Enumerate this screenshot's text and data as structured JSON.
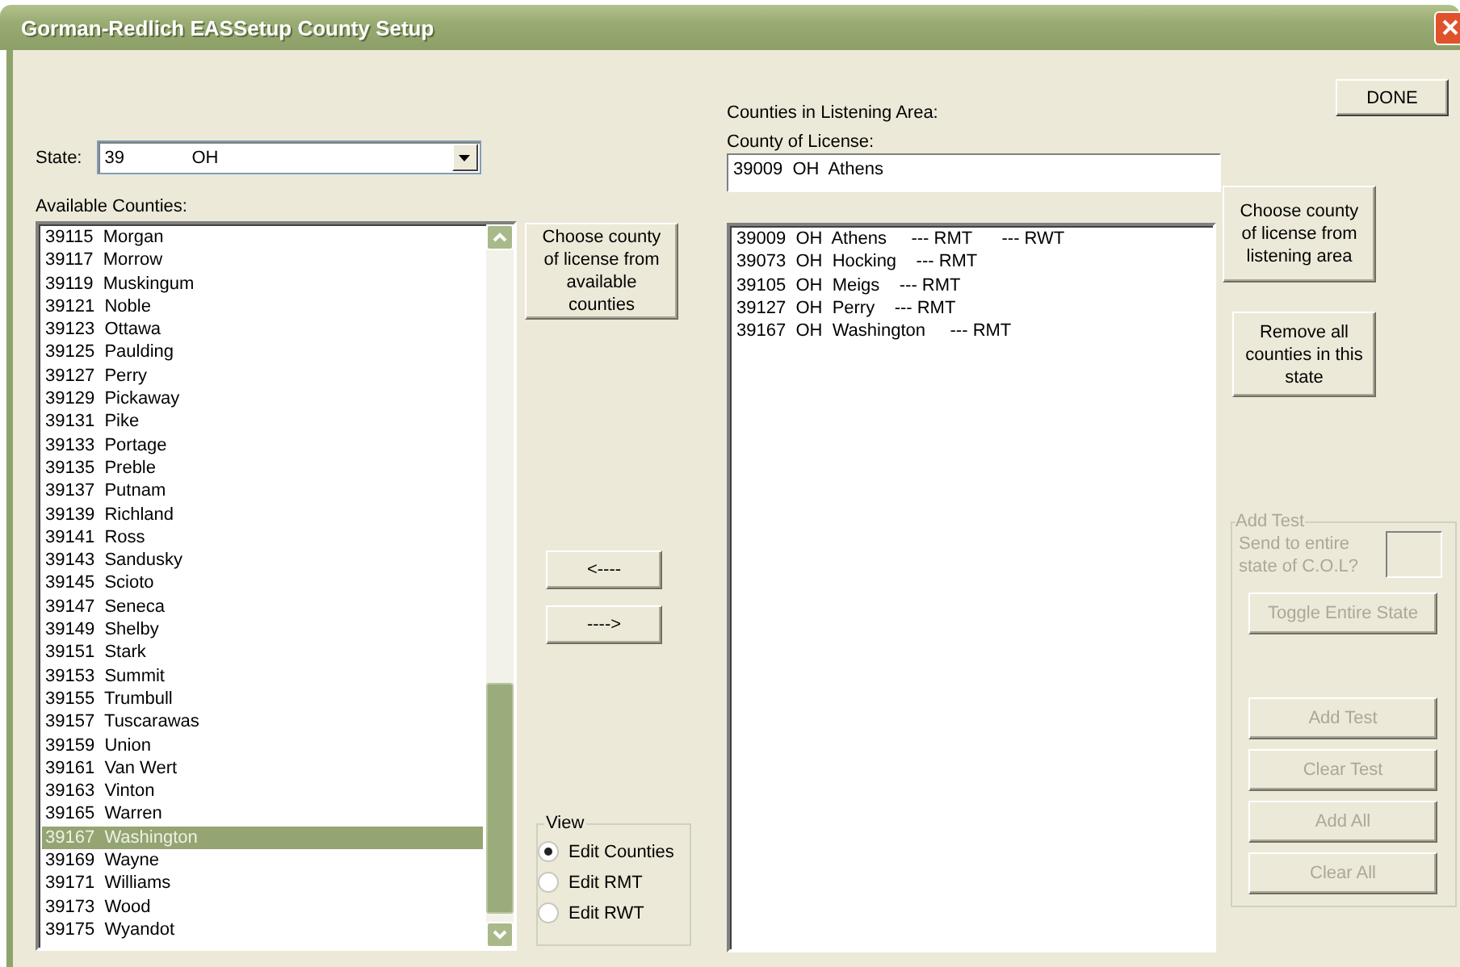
{
  "window": {
    "title": "Gorman-Redlich EASSetup County Setup"
  },
  "done_button": "DONE",
  "state": {
    "label": "State:",
    "code": "39",
    "abbr": "OH"
  },
  "available": {
    "label": "Available Counties:",
    "items": [
      {
        "text": "39115  Morgan",
        "selected": false
      },
      {
        "text": "39117  Morrow",
        "selected": false
      },
      {
        "text": "39119  Muskingum",
        "selected": false
      },
      {
        "text": "39121  Noble",
        "selected": false
      },
      {
        "text": "39123  Ottawa",
        "selected": false
      },
      {
        "text": "39125  Paulding",
        "selected": false
      },
      {
        "text": "39127  Perry",
        "selected": false
      },
      {
        "text": "39129  Pickaway",
        "selected": false
      },
      {
        "text": "39131  Pike",
        "selected": false
      },
      {
        "text": "39133  Portage",
        "selected": false
      },
      {
        "text": "39135  Preble",
        "selected": false
      },
      {
        "text": "39137  Putnam",
        "selected": false
      },
      {
        "text": "39139  Richland",
        "selected": false
      },
      {
        "text": "39141  Ross",
        "selected": false
      },
      {
        "text": "39143  Sandusky",
        "selected": false
      },
      {
        "text": "39145  Scioto",
        "selected": false
      },
      {
        "text": "39147  Seneca",
        "selected": false
      },
      {
        "text": "39149  Shelby",
        "selected": false
      },
      {
        "text": "39151  Stark",
        "selected": false
      },
      {
        "text": "39153  Summit",
        "selected": false
      },
      {
        "text": "39155  Trumbull",
        "selected": false
      },
      {
        "text": "39157  Tuscarawas",
        "selected": false
      },
      {
        "text": "39159  Union",
        "selected": false
      },
      {
        "text": "39161  Van Wert",
        "selected": false
      },
      {
        "text": "39163  Vinton",
        "selected": false
      },
      {
        "text": "39165  Warren",
        "selected": false
      },
      {
        "text": "39167  Washington",
        "selected": true
      },
      {
        "text": "39169  Wayne",
        "selected": false
      },
      {
        "text": "39171  Williams",
        "selected": false
      },
      {
        "text": "39173  Wood",
        "selected": false
      },
      {
        "text": "39175  Wyandot",
        "selected": false
      }
    ]
  },
  "choose_from_available": "Choose county of license from available counties",
  "move_left": "<----",
  "move_right": "---->",
  "view": {
    "label": "View",
    "options": [
      {
        "label": "Edit Counties",
        "selected": true
      },
      {
        "label": "Edit RMT",
        "selected": false
      },
      {
        "label": "Edit RWT",
        "selected": false
      }
    ]
  },
  "listening": {
    "label": "Counties in Listening Area:",
    "license_label": "County of License:",
    "license_value": "39009  OH  Athens",
    "items": [
      "39009  OH  Athens     --- RMT      --- RWT",
      "39073  OH  Hocking    --- RMT",
      "39105  OH  Meigs    --- RMT",
      "39127  OH  Perry    --- RMT",
      "39167  OH  Washington     --- RMT"
    ]
  },
  "choose_from_listening": "Choose county of license from listening area",
  "remove_all": "Remove all counties in this state",
  "add_test": {
    "label": "Add Test",
    "disabled": true,
    "send_label": "Send to entire state of C.O.L?",
    "toggle": "Toggle Entire State",
    "buttons": [
      "Add Test",
      "Clear Test",
      "Add All",
      "Clear All"
    ]
  }
}
